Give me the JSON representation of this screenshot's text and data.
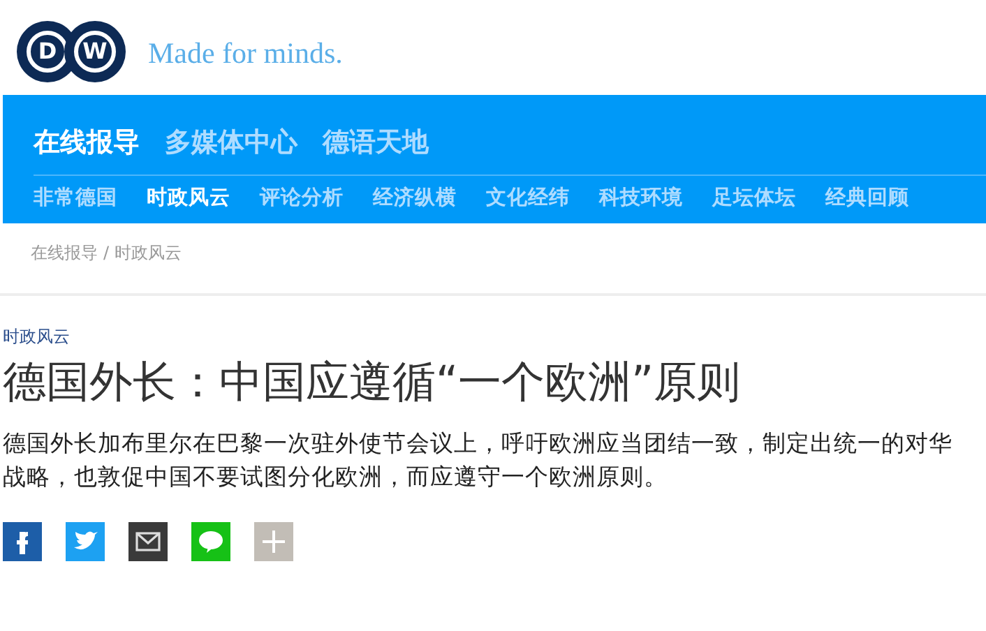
{
  "logo": {
    "letters": [
      "D",
      "W"
    ],
    "tagline": "Made for minds."
  },
  "main_nav": [
    {
      "label": "在线报导",
      "selected": true
    },
    {
      "label": "多媒体中心",
      "selected": false
    },
    {
      "label": "德语天地",
      "selected": false
    }
  ],
  "sub_nav": [
    {
      "label": "非常德国",
      "selected": false
    },
    {
      "label": "时政风云",
      "selected": true
    },
    {
      "label": "评论分析",
      "selected": false
    },
    {
      "label": "经济纵横",
      "selected": false
    },
    {
      "label": "文化经纬",
      "selected": false
    },
    {
      "label": "科技环境",
      "selected": false
    },
    {
      "label": "足坛体坛",
      "selected": false
    },
    {
      "label": "经典回顾",
      "selected": false
    }
  ],
  "breadcrumb": [
    "在线报导",
    "时政风云"
  ],
  "breadcrumb_separator": "/",
  "article": {
    "category": "时政风云",
    "headline": "德国外长：中国应遵循“一个欧洲”原则",
    "lead": "德国外长加布里尔在巴黎一次驻外使节会议上，呼吁欧洲应当团结一致，制定出统一的对华战略，也敦促中国不要试图分化欧洲，而应遵守一个欧洲原则。"
  },
  "share_buttons": [
    {
      "kind": "facebook"
    },
    {
      "kind": "twitter"
    },
    {
      "kind": "email"
    },
    {
      "kind": "line"
    },
    {
      "kind": "more"
    }
  ]
}
